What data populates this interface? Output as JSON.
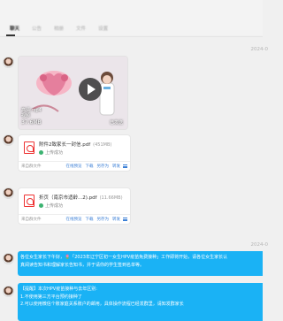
{
  "tabs": [
    "聊天",
    "公告",
    "相册",
    "文件",
    "设置"
  ],
  "dates": [
    "2024-0",
    "2024-0"
  ],
  "video": {
    "meta_line1": "高清 mp4",
    "meta_line2": "视频",
    "size": "37.6MB",
    "status": "已发送"
  },
  "files": [
    {
      "name": "附件2致家长一封信.pdf",
      "size": "(451MB)",
      "status": "上传成功",
      "source": "来自群文件",
      "actions": [
        "在线预览",
        "下载",
        "另存为",
        "转发"
      ]
    },
    {
      "name": "折页（南京市适龄...2).pdf",
      "size": "(11.66MB)",
      "status": "上传成功",
      "source": "来自群文件",
      "actions": [
        "在线预览",
        "下载",
        "另存为",
        "转发"
      ]
    }
  ],
  "messages": [
    {
      "lines": [
        "各位女生家长下午好，🌷「2023年辽宁区初一女生HPV疫苗免费接种」工作即将开始，请各位女生家长认",
        "真阅读告知书和理解家长告知书，并于请你的学生签到名单等。"
      ]
    },
    {
      "lines": [
        "【提醒】本次HPV疫苗接种与去年区别:",
        "1.不使用第三方平台预约接种了",
        "2.可以使用微信个账家庭关系账户的邮用，具体操作流程已经发群里，请知发群家长"
      ]
    }
  ],
  "colors": {
    "bubble": "#1ab2f5",
    "link": "#3b7fd6",
    "pdf": "#ee3333"
  }
}
